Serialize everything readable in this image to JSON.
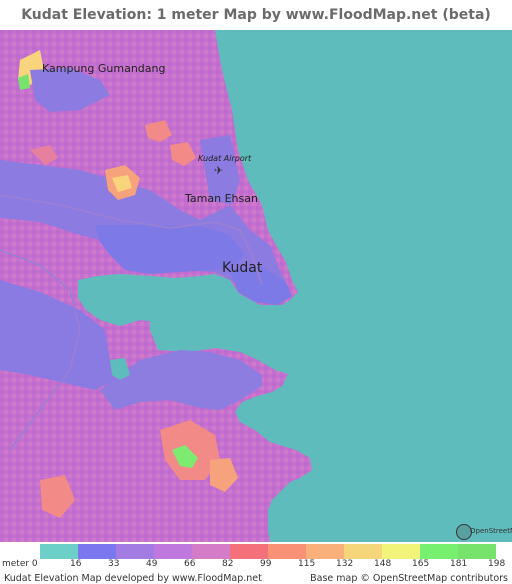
{
  "title": "Kudat Elevation: 1 meter Map by www.FloodMap.net (beta)",
  "places": [
    {
      "name": "Kampung Gumandang",
      "size": "small"
    },
    {
      "name": "Kudat Airport",
      "size": "tiny"
    },
    {
      "name": "Taman Ehsan",
      "size": "small"
    },
    {
      "name": "Kudat",
      "size": "large"
    }
  ],
  "legend": {
    "unit_label": "meter",
    "ticks": [
      "0",
      "16",
      "33",
      "49",
      "66",
      "82",
      "99",
      "115",
      "132",
      "148",
      "165",
      "181",
      "198"
    ],
    "colors": [
      "#6ccfc8",
      "#7b78ef",
      "#a27be3",
      "#bf78de",
      "#d57cc9",
      "#f4707b",
      "#f99176",
      "#f9b07a",
      "#f6d67b",
      "#f1f478",
      "#77f06f",
      "#77e36c"
    ]
  },
  "credits": {
    "left": "Kudat Elevation Map developed by www.FloodMap.net",
    "right": "Base map © OpenStreetMap contributors",
    "osm_logo_text": "OpenStreetMap"
  },
  "map": {
    "sea_color": "#5fbcbc",
    "land_color": "#c16fcf",
    "low_land_color": "#8d7ce0"
  }
}
